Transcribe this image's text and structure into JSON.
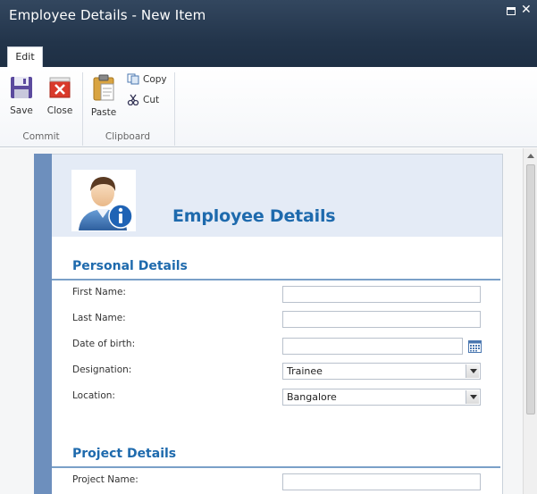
{
  "window": {
    "title": "Employee Details - New Item"
  },
  "ribbon": {
    "tabs": [
      {
        "label": "Edit",
        "active": true
      }
    ],
    "commit": {
      "group_label": "Commit",
      "save_label": "Save",
      "close_label": "Close"
    },
    "clipboard": {
      "group_label": "Clipboard",
      "paste_label": "Paste",
      "copy_label": "Copy",
      "cut_label": "Cut"
    }
  },
  "form": {
    "title": "Employee Details",
    "personal": {
      "title": "Personal Details",
      "fields": {
        "first_name": {
          "label": "First Name:",
          "value": ""
        },
        "last_name": {
          "label": "Last Name:",
          "value": ""
        },
        "dob": {
          "label": "Date of birth:",
          "value": ""
        },
        "designation": {
          "label": "Designation:",
          "value": "Trainee"
        },
        "location": {
          "label": "Location:",
          "value": "Bangalore"
        }
      }
    },
    "project": {
      "title": "Project Details",
      "fields": {
        "project_name": {
          "label": "Project Name:",
          "value": ""
        }
      }
    }
  },
  "colors": {
    "accent": "#1e6aad",
    "titlebar": "#2b3e55",
    "sidebar": "#6d8fbd",
    "header_band": "#e4ebf6"
  }
}
